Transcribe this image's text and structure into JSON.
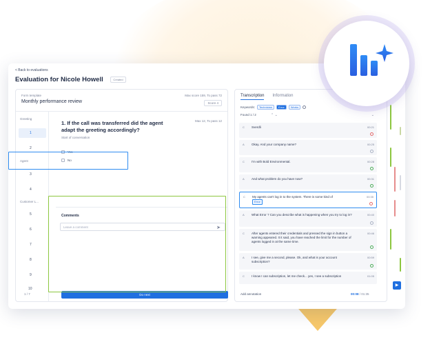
{
  "header": {
    "back_label": "< Back to evaluations",
    "title": "Evaluation for Nicole Howell",
    "status_tag": "Created"
  },
  "form": {
    "template_label": "Form template",
    "template_name": "Monthly performance review",
    "max_score": "Max score 159, To pass 72",
    "score_button": "Score 4"
  },
  "nav": {
    "sections": [
      "Greeting",
      "Agent",
      "Customer L..."
    ],
    "numbers": [
      "1",
      "2",
      "3",
      "4",
      "5",
      "6",
      "7",
      "8",
      "9",
      "10"
    ],
    "pager": "1 / 7"
  },
  "question": {
    "text": "1. If the call was transferred did the agent adapt the greeting accordingly?",
    "subtitle": "Start of conversation",
    "weight": "Max 12, To pass 12",
    "options": [
      "Yes",
      "No"
    ]
  },
  "comments": {
    "label": "Comments",
    "placeholder": "Leave a comment"
  },
  "actions": {
    "do_next": "Do next"
  },
  "transcript": {
    "tabs": [
      "Transcription",
      "Information"
    ],
    "keywords_label": "Keywords:",
    "keywords": [
      "Technician",
      "Error",
      "Works"
    ],
    "found": "Found 1 / 2",
    "messages": [
      {
        "speaker": "C",
        "text": "Sverdli",
        "time": "00:21",
        "status": "red"
      },
      {
        "speaker": "A",
        "text": "Okay. And your company name?",
        "time": "00:25",
        "status": "neutral"
      },
      {
        "speaker": "C",
        "text": "I'm with Bold Environmental.",
        "time": "00:28",
        "status": "green"
      },
      {
        "speaker": "A",
        "text": "And what problem do you have now?",
        "time": "00:31",
        "status": "green"
      },
      {
        "speaker": "C",
        "text": "My agents can't log in to the system. There is some kind of",
        "time": "00:35",
        "status": "red",
        "chip": "Error"
      },
      {
        "speaker": "A",
        "text": "What Error ? Can you describe what is happening when you try to log in?",
        "time": "00:40",
        "status": "neutral"
      },
      {
        "speaker": "C",
        "text": "After agents entered their credentials and pressed the sign in button a warning appeared. It it said, you have reached the limit for the number of agents logged in at the same time.",
        "time": "00:46",
        "status": "green"
      },
      {
        "speaker": "A",
        "text": "I see, give me a second, please. Ok, and what is your account subscription?",
        "time": "00:59",
        "status": "green"
      },
      {
        "speaker": "C",
        "text": "I know I can subscription, let me check... yes, I see a subscription",
        "time": "01:05",
        "status": "neutral"
      }
    ],
    "add_annotation": "Add annotation",
    "time_current": "00:08",
    "time_total": "01:35"
  },
  "colors": {
    "accent": "#1f6fe0",
    "highlight_blue": "#2e8bf0",
    "highlight_green": "#8cc63f",
    "arrow_yellow": "#f7c86a"
  },
  "icons": {
    "logo": "bars-sparkle-logo-icon",
    "send": "send-icon",
    "info": "info-icon",
    "play": "play-icon"
  }
}
